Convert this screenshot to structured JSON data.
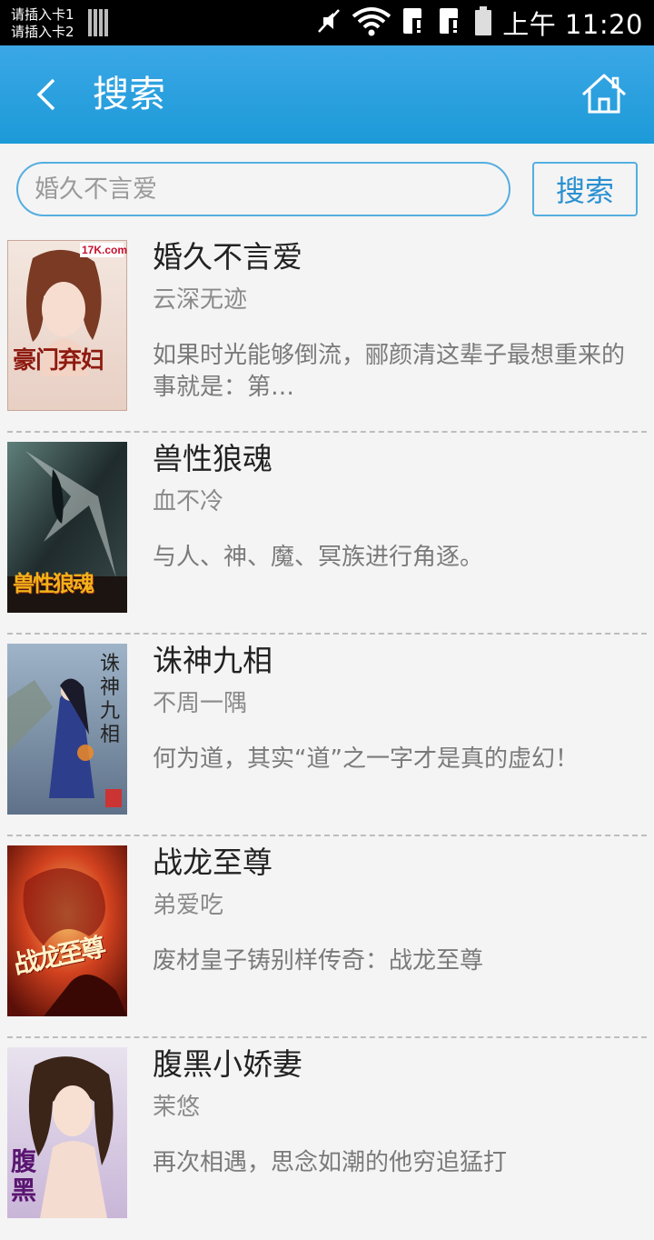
{
  "status_bar": {
    "sim1": "请插入卡1",
    "sim2": "请插入卡2",
    "time": "上午 11:20"
  },
  "app_bar": {
    "title": "搜索",
    "back_icon": "chevron-left-icon",
    "home_icon": "home-icon"
  },
  "search": {
    "value": "",
    "placeholder": "婚久不言爱",
    "button_label": "搜索"
  },
  "books": [
    {
      "title": "婚久不言爱",
      "author": "云深无迹",
      "description": "如果时光能够倒流，郦颜清这辈子最想重来的事就是：第…",
      "cover_text": "豪门弃妇"
    },
    {
      "title": "兽性狼魂",
      "author": "血不冷",
      "description": "与人、神、魔、冥族进行角逐。",
      "cover_text": "兽性狼魂"
    },
    {
      "title": "诛神九相",
      "author": "不周一隅",
      "description": "何为道，其实“道”之一字才是真的虚幻！",
      "cover_text": "诛神九相"
    },
    {
      "title": "战龙至尊",
      "author": "弟爱吃",
      "description": "废材皇子铸别样传奇：战龙至尊",
      "cover_text": "战龙至尊"
    },
    {
      "title": "腹黑小娇妻",
      "author": "茉悠",
      "description": "再次相遇，思念如潮的他穷追猛打",
      "cover_text": "腹黑"
    }
  ],
  "colors": {
    "app_bar": "#1d9ad8",
    "accent_border": "#54aee0",
    "background": "#f4f4f4"
  }
}
